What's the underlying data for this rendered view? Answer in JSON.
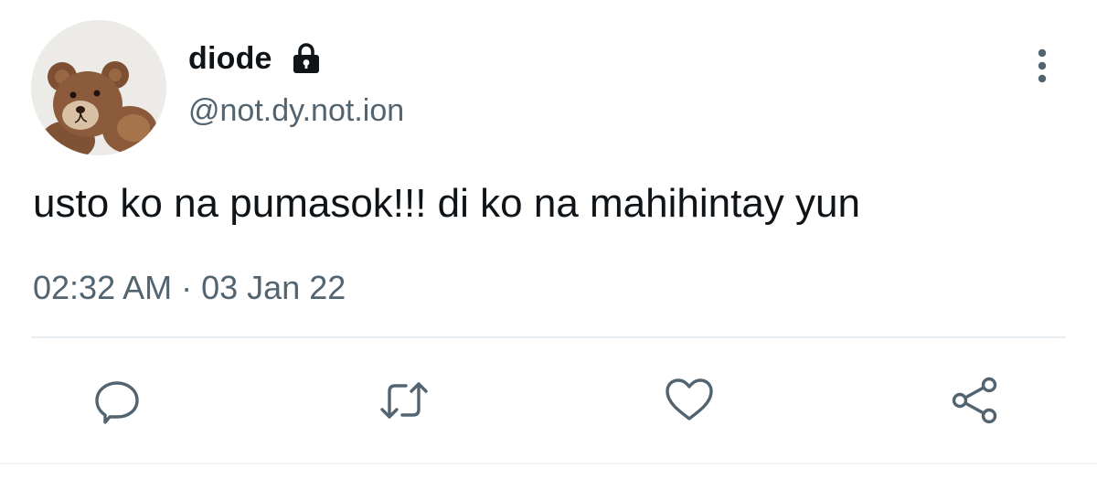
{
  "user": {
    "display_name": "diode",
    "handle": "@not.dy.not.ion",
    "avatar": "teddy-bear-avatar",
    "protected_icon": "lock-icon"
  },
  "tweet": {
    "text": "usto ko na pumasok!!! di ko na mahihintay yun",
    "time": "02:32 AM",
    "separator": "·",
    "date": "03 Jan 22"
  },
  "actions": [
    {
      "name": "reply",
      "icon": "comment-icon"
    },
    {
      "name": "retweet",
      "icon": "retweet-icon"
    },
    {
      "name": "like",
      "icon": "heart-icon"
    },
    {
      "name": "share",
      "icon": "share-icon"
    }
  ],
  "colors": {
    "text": "#0f1419",
    "secondary": "#536471",
    "divider": "#e6ecf0",
    "icon": "#536471"
  }
}
